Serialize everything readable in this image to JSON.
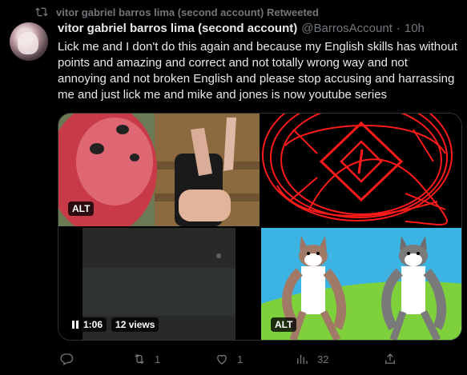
{
  "retweet": {
    "label": "vitor gabriel barros lima (second account) Retweeted",
    "icon": "retweet-icon"
  },
  "tweet": {
    "display_name": "vitor gabriel barros lima (second account)",
    "handle": "@BarrosAccount",
    "separator": "·",
    "time": "10h",
    "text": "Lick me and I don't do this again and because my English skills has without points and amazing and correct and not totally wrong way and not annoying and not broken English and please stop accusing and harrassing me and just lick me and mike and jones is now youtube series"
  },
  "media": {
    "alt_label": "ALT",
    "video": {
      "duration": "1:06",
      "views": "12 views"
    }
  },
  "actions": {
    "reply_icon": "reply-icon",
    "retweet_count": "1",
    "like_count": "1",
    "views_count": "32",
    "share_icon": "share-icon"
  },
  "colors": {
    "background": "#000000",
    "text": "#e7e9ea",
    "muted": "#71767b",
    "border": "#2f3336"
  }
}
